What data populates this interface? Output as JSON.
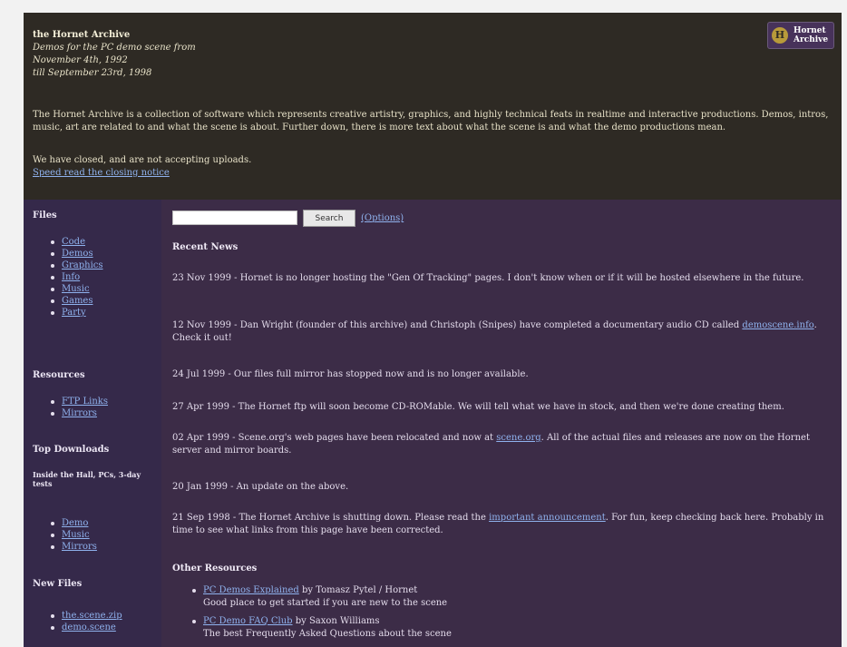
{
  "header": {
    "title": "the Hornet Archive",
    "line2": "Demos for the PC demo scene from",
    "line3": "November 4th, 1992",
    "line4": "till September 23rd, 1998",
    "intro": "The Hornet Archive is a collection of software which represents creative artistry, graphics, and highly technical feats in realtime and interactive productions. Demos, intros, music, art are related to and what the scene is about. Further down, there is more text about what the scene is and what the demo productions mean.",
    "closed_1": "We have closed, and are not accepting uploads.",
    "closed_2": "Speed read the closing notice",
    "logo_text_1": "Hornet",
    "logo_text_2": "Archive"
  },
  "sidebar": {
    "files_heading": "Files",
    "files": [
      "Code",
      "Demos",
      "Graphics",
      "Info",
      "Music",
      "Games",
      "Party"
    ],
    "resources_heading": "Resources",
    "resources": [
      "FTP Links",
      "Mirrors"
    ],
    "top_heading": "Top Downloads",
    "top_sub": "Inside the Hall, PCs, 3-day tests",
    "top_items": [
      "Demo",
      "Music",
      "Mirrors"
    ],
    "new_heading": "New Files",
    "new_items": [
      "the.scene.zip",
      "demo.scene"
    ]
  },
  "search": {
    "placeholder": "",
    "button": "Search",
    "options": "(Options)"
  },
  "news": {
    "title": "Recent News",
    "items": [
      "23 Nov 1999 - Hornet is no longer hosting the \"Gen Of Tracking\" pages. I don't know when or if it will be hosted elsewhere in the future.",
      "12 Nov 1999 - Dan Wright (founder of this archive) and Christoph (Snipes) have completed a documentary audio CD called",
      "demoscene.info",
      ". Check it out!",
      "24 Jul 1999 - Our files full mirror has stopped now and is no longer available.",
      "27 Apr 1999 - The Hornet ftp will soon become CD-ROMable. We will tell what we have in stock, and then we're done creating them.",
      "02 Apr 1999 - Scene.org's web pages have been relocated and now at",
      "scene.org",
      ". All of the actual files and releases are now on the Hornet server and mirror boards.",
      "20 Jan 1999 - An update on the above.",
      "21 Sep 1998 - The Hornet Archive is shutting down. Please read the",
      "important announcement",
      ". For fun, keep checking back here. Probably in time to see what links from this page have been corrected."
    ]
  },
  "other": {
    "heading": "Other Resources",
    "items": [
      {
        "link": "PC Demos Explained",
        "text": " by Tomasz Pytel / Hornet",
        "sub": "Good place to get started if you are new to the scene"
      },
      {
        "link": "PC Demo FAQ Club",
        "text": " by Saxon Williams",
        "sub": "The best Frequently Asked Questions about the scene"
      }
    ]
  }
}
